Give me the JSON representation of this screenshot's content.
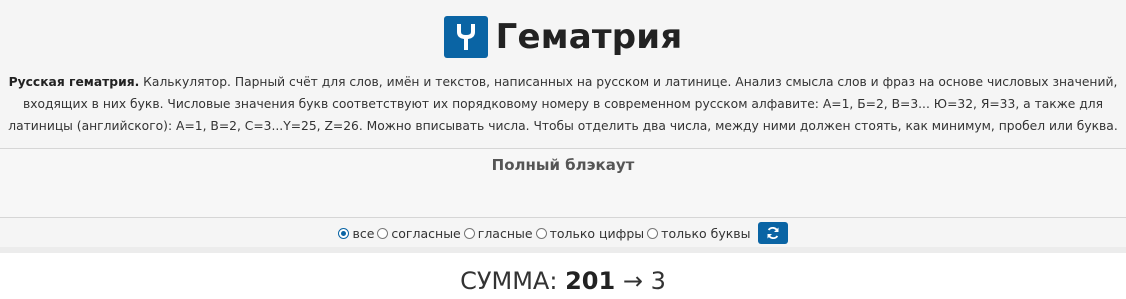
{
  "header": {
    "title": "Гематрия",
    "logo_icon": "y-fork-logo-icon",
    "description_lead": "Русская гематрия.",
    "description_text": " Калькулятор. Парный счёт для слов, имён и текстов, написанных на русском и латинице. Анализ смысла слов и фраз на основе числовых значений, входящих в них букв. Числовые значения букв соответствуют их порядковому номеру в современном русском алфавите: А=1, Б=2, В=3... Ю=32, Я=33, а также для латиницы (английского): A=1, B=2, C=3...Y=25, Z=26. Можно вписывать числа. Чтобы отделить два числа, между ними должен стоять, как минимум, пробел или буква."
  },
  "input": {
    "text": "Полный блэкаут"
  },
  "options": {
    "selected": "все",
    "items": [
      {
        "label": "все",
        "checked": true
      },
      {
        "label": "согласные",
        "checked": false
      },
      {
        "label": "гласные",
        "checked": false
      },
      {
        "label": "только цифры",
        "checked": false
      },
      {
        "label": "только буквы",
        "checked": false
      }
    ],
    "refresh_icon": "refresh-icon"
  },
  "result": {
    "label": "СУММА:",
    "sum": "201",
    "arrow": "→",
    "reduced": "3"
  },
  "colors": {
    "accent": "#0a64a4",
    "background": "#f5f5f5"
  }
}
